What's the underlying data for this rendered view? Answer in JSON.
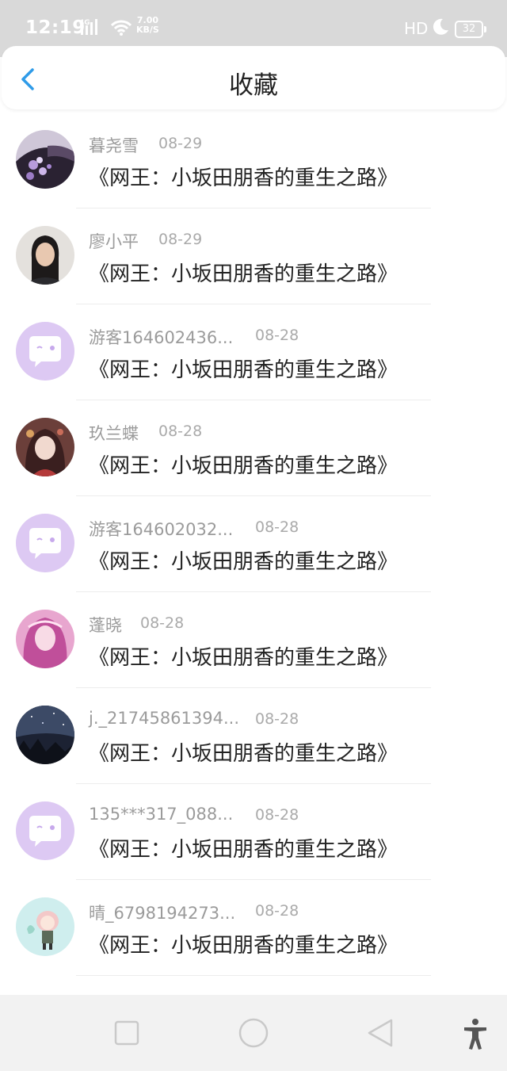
{
  "status_bar": {
    "time": "12:19",
    "network": "4G",
    "speed_value": "7.00",
    "speed_unit": "KB/S",
    "hd": "HD",
    "battery": "32"
  },
  "header": {
    "title": "收藏",
    "back_icon": "chevron-left-icon",
    "accent_color": "#2f9be8"
  },
  "items": [
    {
      "name": "暮尧雪",
      "date": "08-29",
      "book": "《网王：小坂田朋香的重生之路》",
      "avatar": "photo-purple-flowers"
    },
    {
      "name": "廖小平",
      "date": "08-29",
      "book": "《网王：小坂田朋香的重生之路》",
      "avatar": "photo-person"
    },
    {
      "name": "游客164602436...",
      "date": "08-28",
      "book": "《网王：小坂田朋香的重生之路》",
      "avatar": "default-chat-avatar"
    },
    {
      "name": "玖兰蝶",
      "date": "08-28",
      "book": "《网王：小坂田朋香的重生之路》",
      "avatar": "photo-anime-girl"
    },
    {
      "name": "游客164602032...",
      "date": "08-28",
      "book": "《网王：小坂田朋香的重生之路》",
      "avatar": "default-chat-avatar"
    },
    {
      "name": "蓬晓",
      "date": "08-28",
      "book": "《网王：小坂田朋香的重生之路》",
      "avatar": "photo-pink-hair-girl"
    },
    {
      "name": "j._21745861394...",
      "date": "08-28",
      "book": "《网王：小坂田朋香的重生之路》",
      "avatar": "photo-night-sky"
    },
    {
      "name": "135***317_088...",
      "date": "08-28",
      "book": "《网王：小坂田朋香的重生之路》",
      "avatar": "default-chat-avatar"
    },
    {
      "name": "晴_6798194273...",
      "date": "08-28",
      "book": "《网王：小坂田朋香的重生之路》",
      "avatar": "photo-cartoon-chibi"
    }
  ],
  "nav_bar": {
    "buttons": [
      "recents-icon",
      "home-icon",
      "back-icon",
      "accessibility-icon"
    ]
  }
}
